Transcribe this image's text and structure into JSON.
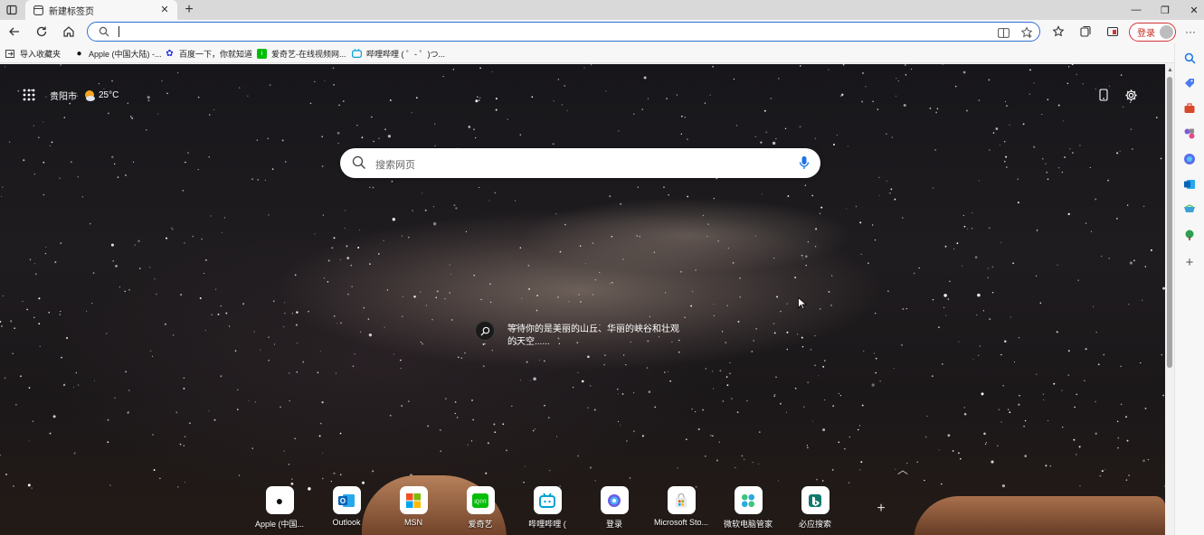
{
  "tab": {
    "title": "新建标签页",
    "close": "✕",
    "new_tab": "+"
  },
  "window": {
    "minimize": "—",
    "restore": "❐",
    "close": "✕"
  },
  "address_bar": {
    "value": "",
    "placeholder": ""
  },
  "account": {
    "login_label": "登录"
  },
  "favorites": [
    {
      "label": "导入收藏夹",
      "icon": "import-icon"
    },
    {
      "label": "Apple (中国大陆) -...",
      "icon": "apple-icon"
    },
    {
      "label": "百度一下，你就知道",
      "icon": "baidu-icon"
    },
    {
      "label": "爱奇艺-在线视频网...",
      "icon": "iqiyi-icon"
    },
    {
      "label": "哔哩哔哩 ( ゜- ゜)つ...",
      "icon": "bilibili-icon"
    }
  ],
  "weather": {
    "city": "贵阳市",
    "temp": "25°C"
  },
  "search": {
    "placeholder": "搜索网页"
  },
  "image_info": {
    "text": "等待你的是美丽的山丘、华丽的峡谷和壮观的天空......"
  },
  "quick_links": [
    {
      "label": "Apple (中国...",
      "icon": "apple-icon"
    },
    {
      "label": "Outlook",
      "icon": "outlook-icon"
    },
    {
      "label": "MSN",
      "icon": "msn-icon"
    },
    {
      "label": "爱奇艺",
      "icon": "iqiyi-icon"
    },
    {
      "label": "哔哩哔哩 (",
      "icon": "bilibili-icon"
    },
    {
      "label": "登录",
      "icon": "copilot-icon"
    },
    {
      "label": "Microsoft Sto...",
      "icon": "store-icon"
    },
    {
      "label": "微软电脑管家",
      "icon": "pc-manager-icon"
    },
    {
      "label": "必应搜索",
      "icon": "bing-icon"
    }
  ],
  "add_link": "+",
  "colors": {
    "accent": "#2f6fd6",
    "login": "#c42b1c"
  }
}
